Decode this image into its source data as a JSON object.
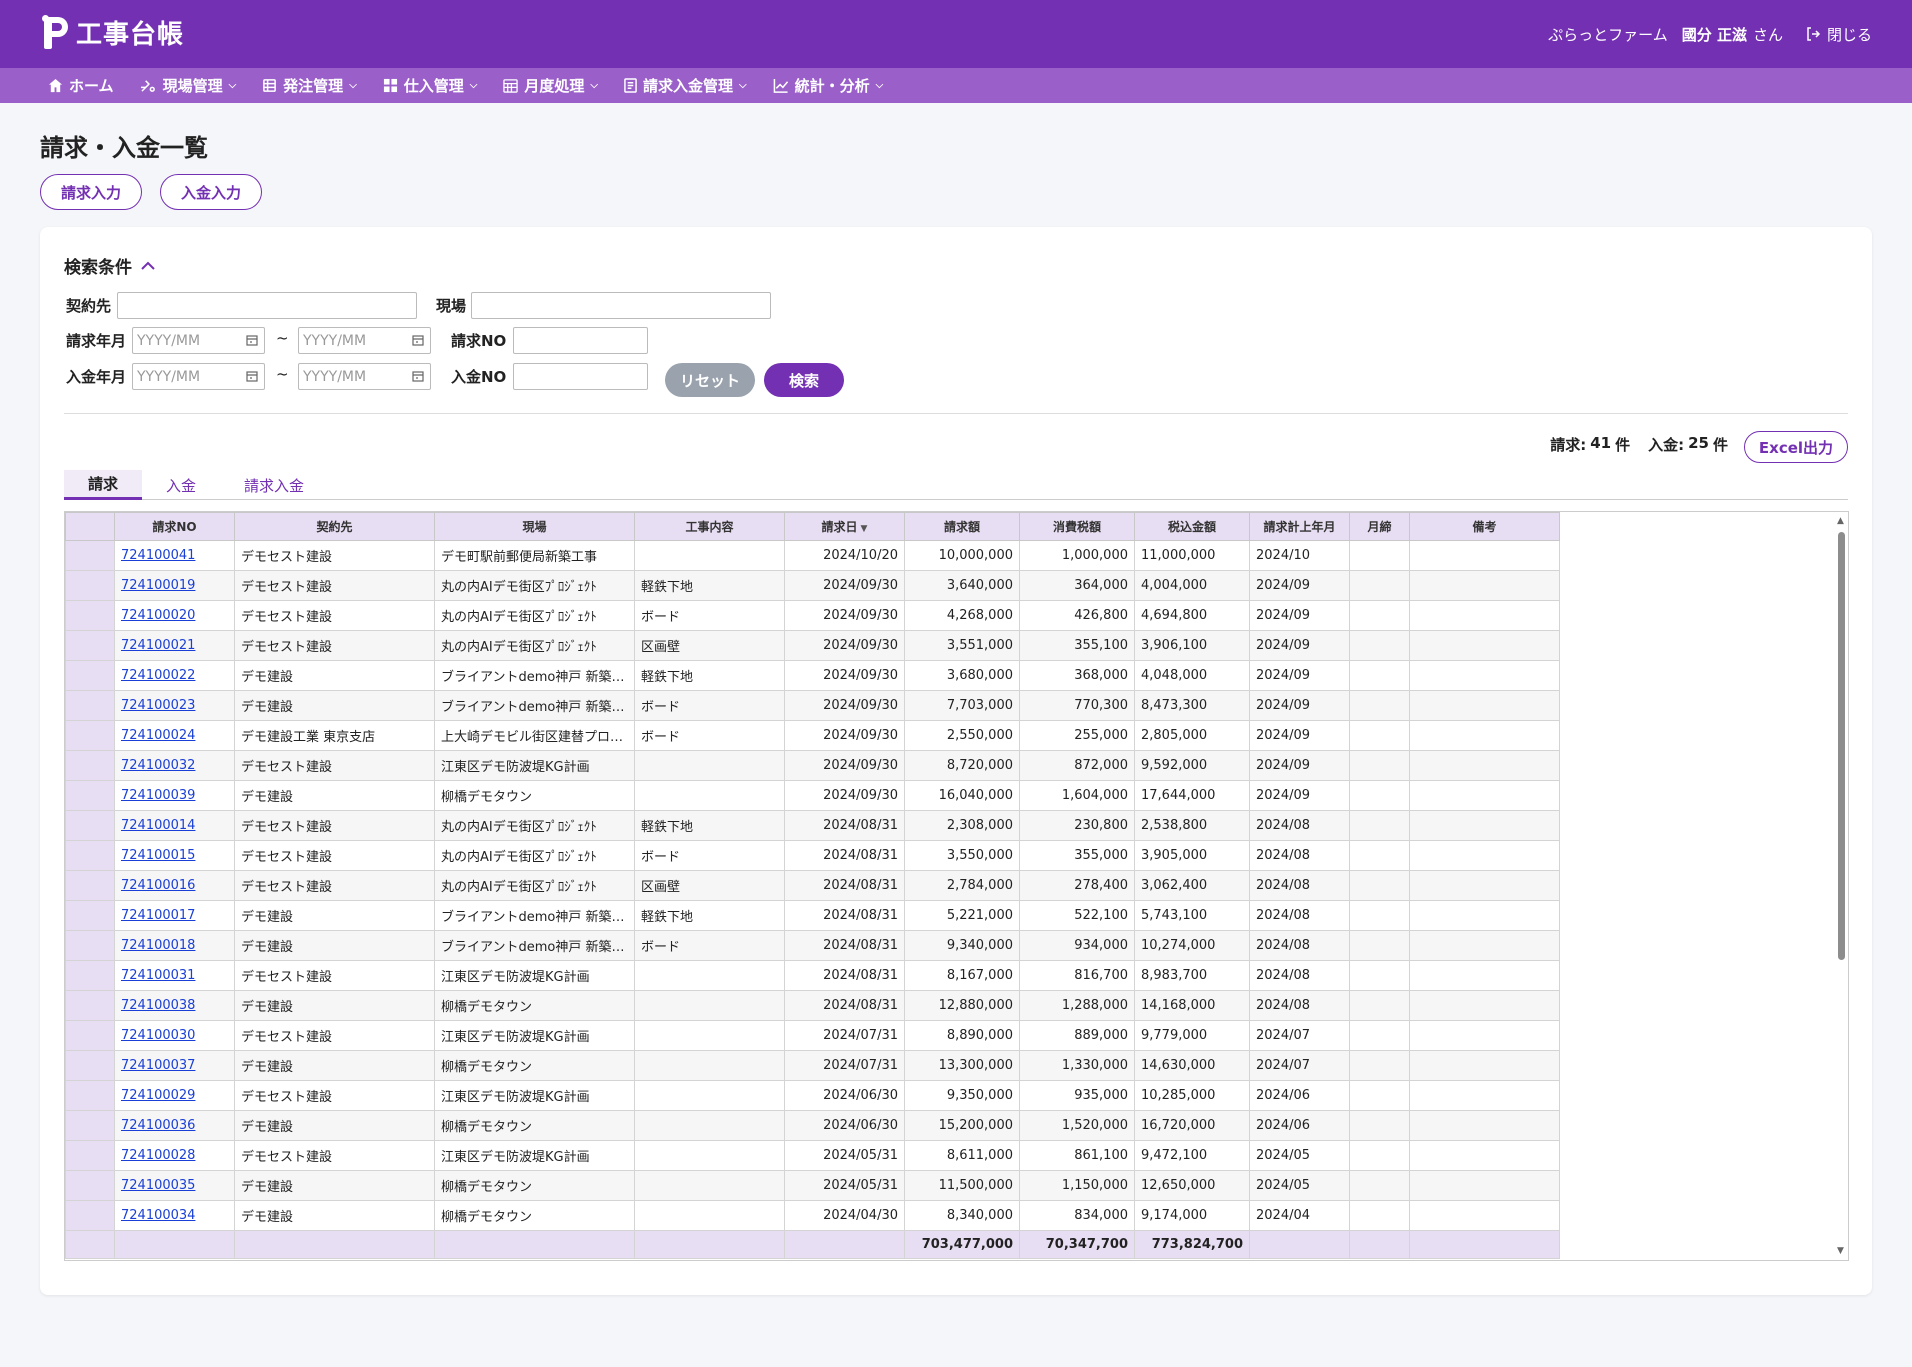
{
  "app": {
    "title": "工事台帳",
    "company": "ぷらっとファーム",
    "user": "國分 正滋",
    "user_suffix": "さん",
    "close_label": "閉じる",
    "accent_color": "#7330b3"
  },
  "nav": [
    {
      "label": "ホーム",
      "icon": "home-icon"
    },
    {
      "label": "現場管理",
      "icon": "construction-icon"
    },
    {
      "label": "発注管理",
      "icon": "order-icon"
    },
    {
      "label": "仕入管理",
      "icon": "purchase-icon"
    },
    {
      "label": "月度処理",
      "icon": "calendar-icon"
    },
    {
      "label": "請求入金管理",
      "icon": "invoice-icon"
    },
    {
      "label": "統計・分析",
      "icon": "chart-icon"
    }
  ],
  "page": {
    "title": "請求・入金一覧",
    "billing_input": "請求入力",
    "payment_input": "入金入力"
  },
  "search": {
    "heading": "検索条件",
    "contractor_label": "契約先",
    "site_label": "現場",
    "billing_month_label": "請求年月",
    "payment_month_label": "入金年月",
    "month_placeholder": "YYYY/MM",
    "tilde": "~",
    "billing_no_label": "請求NO",
    "payment_no_label": "入金NO",
    "reset": "リセット",
    "search": "検索"
  },
  "summary": {
    "billing_label": "請求:",
    "billing_count": "41",
    "payment_label": "入金:",
    "payment_count": "25",
    "unit": "件",
    "excel": "Excel出力"
  },
  "tabs": [
    "請求",
    "入金",
    "請求入金"
  ],
  "table": {
    "columns": [
      "請求NO",
      "契約先",
      "現場",
      "工事内容",
      "請求日",
      "請求額",
      "消費税額",
      "税込金額",
      "請求計上年月",
      "月締",
      "備考"
    ],
    "rows": [
      [
        "724100041",
        "デモセスト建設",
        "デモ町駅前郵便局新築工事",
        "",
        "2024/10/20",
        "10,000,000",
        "1,000,000",
        "11,000,000",
        "2024/10"
      ],
      [
        "724100019",
        "デモセスト建設",
        "丸の内AIデモ街区ﾌﾟﾛｼﾞｪｸﾄ",
        "軽鉄下地",
        "2024/09/30",
        "3,640,000",
        "364,000",
        "4,004,000",
        "2024/09"
      ],
      [
        "724100020",
        "デモセスト建設",
        "丸の内AIデモ街区ﾌﾟﾛｼﾞｪｸﾄ",
        "ボード",
        "2024/09/30",
        "4,268,000",
        "426,800",
        "4,694,800",
        "2024/09"
      ],
      [
        "724100021",
        "デモセスト建設",
        "丸の内AIデモ街区ﾌﾟﾛｼﾞｪｸﾄ",
        "区画壁",
        "2024/09/30",
        "3,551,000",
        "355,100",
        "3,906,100",
        "2024/09"
      ],
      [
        "724100022",
        "デモ建設",
        "ブライアントdemo神戸 新築…",
        "軽鉄下地",
        "2024/09/30",
        "3,680,000",
        "368,000",
        "4,048,000",
        "2024/09"
      ],
      [
        "724100023",
        "デモ建設",
        "ブライアントdemo神戸 新築…",
        "ボード",
        "2024/09/30",
        "7,703,000",
        "770,300",
        "8,473,300",
        "2024/09"
      ],
      [
        "724100024",
        "デモ建設工業 東京支店",
        "上大崎デモビル街区建替プロ…",
        "ボード",
        "2024/09/30",
        "2,550,000",
        "255,000",
        "2,805,000",
        "2024/09"
      ],
      [
        "724100032",
        "デモセスト建設",
        "江東区デモ防波堤KG計画",
        "",
        "2024/09/30",
        "8,720,000",
        "872,000",
        "9,592,000",
        "2024/09"
      ],
      [
        "724100039",
        "デモ建設",
        "柳橋デモタウン",
        "",
        "2024/09/30",
        "16,040,000",
        "1,604,000",
        "17,644,000",
        "2024/09"
      ],
      [
        "724100014",
        "デモセスト建設",
        "丸の内AIデモ街区ﾌﾟﾛｼﾞｪｸﾄ",
        "軽鉄下地",
        "2024/08/31",
        "2,308,000",
        "230,800",
        "2,538,800",
        "2024/08"
      ],
      [
        "724100015",
        "デモセスト建設",
        "丸の内AIデモ街区ﾌﾟﾛｼﾞｪｸﾄ",
        "ボード",
        "2024/08/31",
        "3,550,000",
        "355,000",
        "3,905,000",
        "2024/08"
      ],
      [
        "724100016",
        "デモセスト建設",
        "丸の内AIデモ街区ﾌﾟﾛｼﾞｪｸﾄ",
        "区画壁",
        "2024/08/31",
        "2,784,000",
        "278,400",
        "3,062,400",
        "2024/08"
      ],
      [
        "724100017",
        "デモ建設",
        "ブライアントdemo神戸 新築…",
        "軽鉄下地",
        "2024/08/31",
        "5,221,000",
        "522,100",
        "5,743,100",
        "2024/08"
      ],
      [
        "724100018",
        "デモ建設",
        "ブライアントdemo神戸 新築…",
        "ボード",
        "2024/08/31",
        "9,340,000",
        "934,000",
        "10,274,000",
        "2024/08"
      ],
      [
        "724100031",
        "デモセスト建設",
        "江東区デモ防波堤KG計画",
        "",
        "2024/08/31",
        "8,167,000",
        "816,700",
        "8,983,700",
        "2024/08"
      ],
      [
        "724100038",
        "デモ建設",
        "柳橋デモタウン",
        "",
        "2024/08/31",
        "12,880,000",
        "1,288,000",
        "14,168,000",
        "2024/08"
      ],
      [
        "724100030",
        "デモセスト建設",
        "江東区デモ防波堤KG計画",
        "",
        "2024/07/31",
        "8,890,000",
        "889,000",
        "9,779,000",
        "2024/07"
      ],
      [
        "724100037",
        "デモ建設",
        "柳橋デモタウン",
        "",
        "2024/07/31",
        "13,300,000",
        "1,330,000",
        "14,630,000",
        "2024/07"
      ],
      [
        "724100029",
        "デモセスト建設",
        "江東区デモ防波堤KG計画",
        "",
        "2024/06/30",
        "9,350,000",
        "935,000",
        "10,285,000",
        "2024/06"
      ],
      [
        "724100036",
        "デモ建設",
        "柳橋デモタウン",
        "",
        "2024/06/30",
        "15,200,000",
        "1,520,000",
        "16,720,000",
        "2024/06"
      ],
      [
        "724100028",
        "デモセスト建設",
        "江東区デモ防波堤KG計画",
        "",
        "2024/05/31",
        "8,611,000",
        "861,100",
        "9,472,100",
        "2024/05"
      ],
      [
        "724100035",
        "デモ建設",
        "柳橋デモタウン",
        "",
        "2024/05/31",
        "11,500,000",
        "1,150,000",
        "12,650,000",
        "2024/05"
      ],
      [
        "724100034",
        "デモ建設",
        "柳橋デモタウン",
        "",
        "2024/04/30",
        "8,340,000",
        "834,000",
        "9,174,000",
        "2024/04"
      ]
    ],
    "totals": {
      "amount": "703,477,000",
      "tax": "70,347,700",
      "total": "773,824,700"
    }
  }
}
